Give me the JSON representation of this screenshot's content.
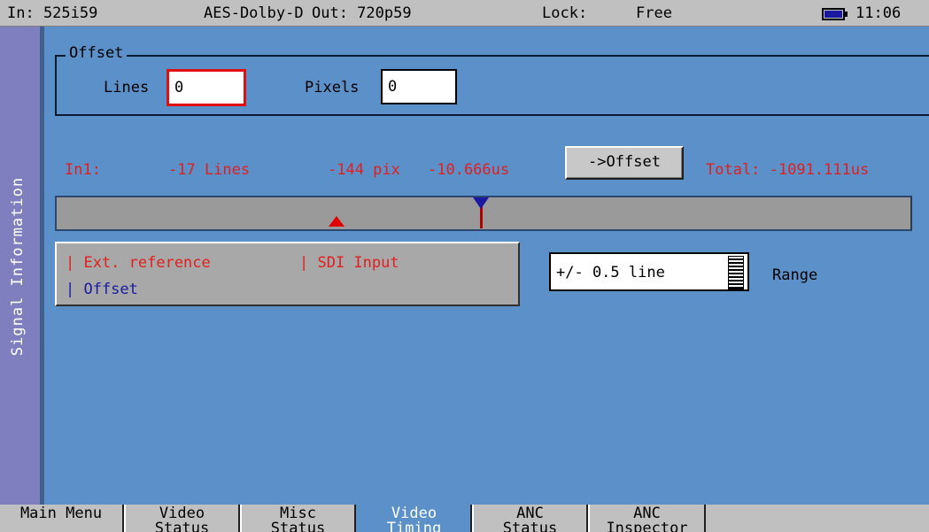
{
  "status_bar": {
    "input": "In: 525i59",
    "audio": "AES-Dolby-D",
    "output": "Out: 720p59",
    "lock_label": "Lock:",
    "lock_value": "Free",
    "battery_icon": "battery-icon",
    "time": "11:06"
  },
  "sidebar": {
    "title": "Signal Information"
  },
  "offset": {
    "legend": "Offset",
    "lines_label": "Lines",
    "lines_value": "0",
    "pixels_label": "Pixels",
    "pixels_value": "0"
  },
  "measurement": {
    "input_label": "In1:",
    "lines": "-17 Lines",
    "pixels": "-144 pix",
    "time": "-10.666us",
    "offset_button": "->Offset",
    "total": "Total: -1091.111us"
  },
  "legend": {
    "ext_reference": "| Ext. reference",
    "sdi_input": "| SDI Input",
    "offset": "| Offset"
  },
  "range": {
    "value": "+/- 0.5 line",
    "label": "Range"
  },
  "tabs": [
    {
      "line1": "Main Menu",
      "line2": ""
    },
    {
      "line1": "Video",
      "line2": "Status"
    },
    {
      "line1": "Misc",
      "line2": "Status"
    },
    {
      "line1": "Video",
      "line2": "Timing"
    },
    {
      "line1": "ANC",
      "line2": "Status"
    },
    {
      "line1": "ANC",
      "line2": "Inspector"
    }
  ],
  "colors": {
    "background": "#5b90c9",
    "highlight_red": "#e02020",
    "marker_blue": "#1a1aa0",
    "sidebar": "#7f7fbf"
  }
}
